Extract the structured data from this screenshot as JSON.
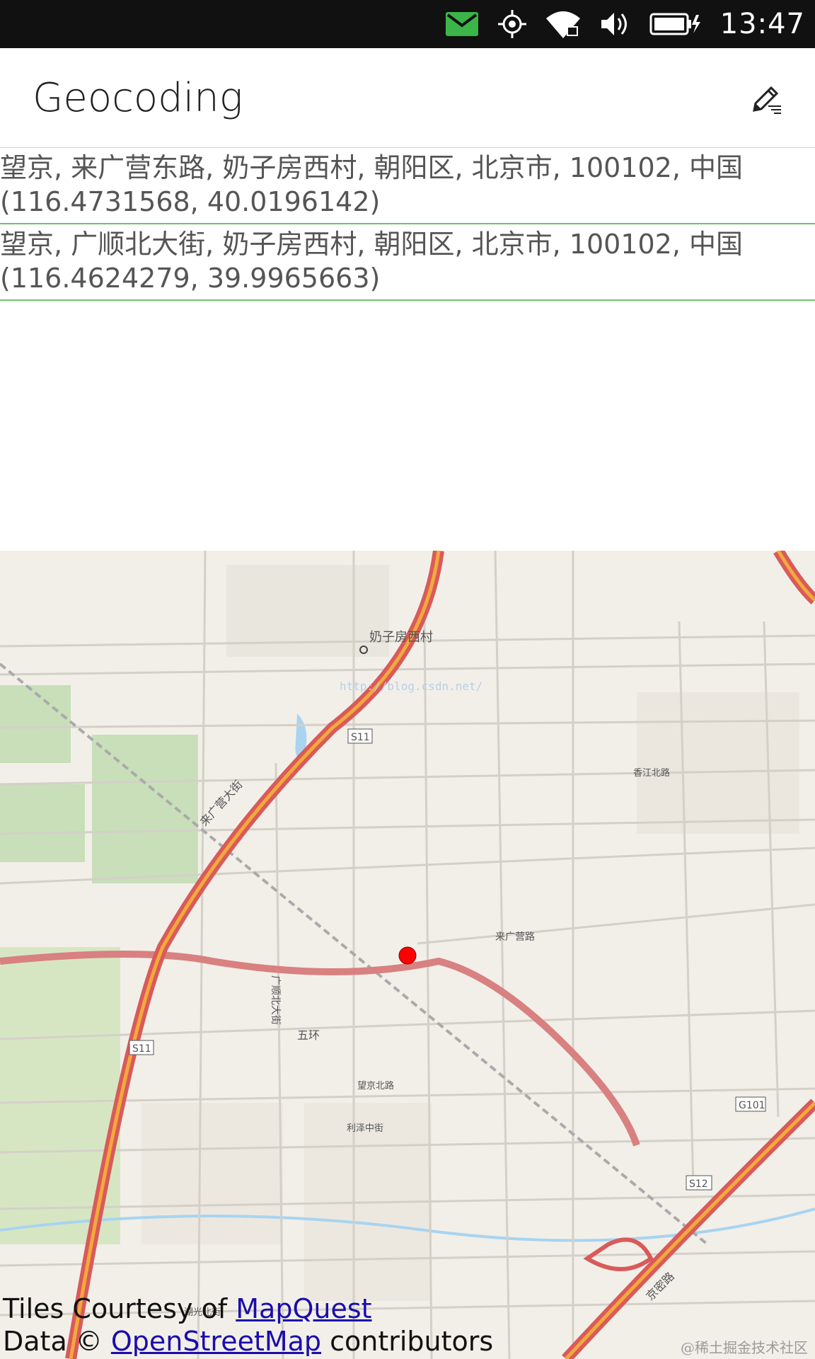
{
  "status_bar": {
    "time": "13:47",
    "icons": [
      "message-icon",
      "location-icon",
      "wifi-icon",
      "volume-icon",
      "battery-icon"
    ],
    "message_color": "#3bb54a"
  },
  "header": {
    "title": "Geocoding",
    "edit_icon": "edit-icon"
  },
  "results": [
    {
      "address": "望京, 来广营东路, 奶子房西村, 朝阳区, 北京市, 100102, 中国",
      "coordinates": "(116.4731568, 40.0196142)"
    },
    {
      "address": "望京, 广顺北大街, 奶子房西村, 朝阳区, 北京市, 100102, 中国",
      "coordinates": "(116.4624279, 39.9965663)"
    }
  ],
  "map": {
    "labels": {
      "village": "奶子房西村",
      "road_s11": "S11",
      "road_laiguangying": "来广营大街",
      "road_laiguangying_road": "来广营路",
      "road_5th_ring": "五环",
      "road_guangshun": "广顺北大街",
      "road_g101": "G101",
      "road_s12": "S12",
      "road_xiangjiang": "香江北路",
      "road_wangjing_north": "望京北路",
      "road_lize": "利泽中街",
      "road_hutong": "湖光北街",
      "road_jingmi": "京密路",
      "watermark_url": "http://blog.csdn.net/"
    },
    "marker_color": "#ff0000",
    "highway_color": "#d95a5a",
    "highway_inner_color": "#f2a93b",
    "attribution": {
      "line1_prefix": "Tiles Courtesy of ",
      "line1_link": "MapQuest",
      "line2_prefix": "Data © ",
      "line2_link": "OpenStreetMap",
      "line2_suffix": " contributors"
    }
  },
  "watermark": "@稀土掘金技术社区"
}
